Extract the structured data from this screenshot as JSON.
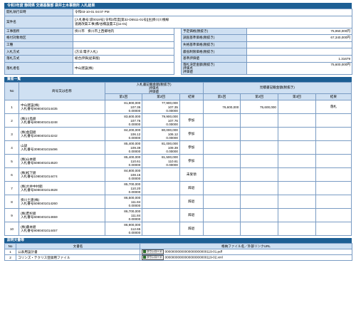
{
  "title": "令和3年度 静岡県 交通基盤部 袋井土木事務所 入札結果",
  "info": {
    "rows": [
      {
        "label": "開札執行日時",
        "value": "令和03-10-01 04:07 PM"
      },
      {
        "label": "案件名",
        "value": "[入札番号:袋0019号] 令和3年度[第32-D5511-01号][主]掛川川根線\n道路改築工事(橋/谷橋設置工)[11-01]"
      },
      {
        "label": "工事箇所",
        "value": "掛川市　掛川市上西郷地内"
      },
      {
        "label": "格付対象地区",
        "value": ""
      },
      {
        "label": "工種",
        "value": ""
      },
      {
        "label": "入札方式",
        "value": "(方法:電子入札)"
      },
      {
        "label": "落札方式",
        "value": "総合評価(従来版)"
      },
      {
        "label": "落札者名",
        "value": "中山建設(株)"
      }
    ],
    "right": [
      {
        "label": "予定価格(税抜き)",
        "value": "75,950,000円"
      },
      {
        "label": "調査基準価格(税抜き)",
        "value": "67,340,000円"
      },
      {
        "label": "失格基準価格(税抜き)",
        "value": ""
      },
      {
        "label": "最低制限価格(税抜き)",
        "value": ""
      },
      {
        "label": "基準評価値",
        "value": "1.31679"
      },
      {
        "label": "落札決定金額(税抜き)\n評価点\n評価値",
        "value": "75,600,000円"
      }
    ]
  },
  "bidders": {
    "section_title": "業者一覧",
    "headers": {
      "no": "No",
      "name": "商号又は名称",
      "bid_group": "入札書記載金額(税抜き)\n評価点\n評価値",
      "round1": "第1回",
      "round2": "第2回",
      "result": "結果",
      "neg_group": "見積書記載金額(税抜き)",
      "neg1": "第1回",
      "neg2": "第2回",
      "neg3": "第3回",
      "neg_result": "結果"
    },
    "rows": [
      {
        "no": "1",
        "name": "中山建設(株)",
        "reg": "入札番号9080401014435",
        "r1": [
          "81,800,000",
          "107.35",
          "0.00000"
        ],
        "r2": [
          "77,900,000",
          "107.35",
          "0.00000"
        ],
        "result": "",
        "n1": "76,600,000",
        "n2": "75,600,000",
        "n3": "",
        "nres": "落札"
      },
      {
        "no": "2",
        "name": "(株)川島組",
        "reg": "入札番号8080401014248",
        "r1": [
          "83,600,000",
          "107.76",
          "0.00000"
        ],
        "r2": [
          "79,900,000",
          "107.76",
          "0.00000"
        ],
        "result": "参加",
        "n1": "",
        "n2": "",
        "n3": "",
        "nres": ""
      },
      {
        "no": "3",
        "name": "(株)金田組",
        "reg": "入札番号2080401014242",
        "r1": [
          "84,200,000",
          "106.12",
          "0.00000"
        ],
        "r2": [
          "80,000,000",
          "106.12",
          "0.00000"
        ],
        "result": "参加",
        "n1": "",
        "n2": "",
        "n3": "",
        "nres": ""
      },
      {
        "no": "4",
        "name": "山訓",
        "reg": "入札番号3080401015496",
        "r1": [
          "85,400,000",
          "109.39",
          "0.00000"
        ],
        "r2": [
          "81,000,000",
          "109.39",
          "0.00000"
        ],
        "result": "参加",
        "n1": "",
        "n2": "",
        "n3": "",
        "nres": ""
      },
      {
        "no": "5",
        "name": "(株)山本組",
        "reg": "入札番号5080401014520",
        "r1": [
          "85,400,000",
          "110.61",
          "0.00000"
        ],
        "r2": [
          "81,500,000",
          "110.61",
          "0.00000"
        ],
        "result": "参加",
        "n1": "",
        "n2": "",
        "n3": "",
        "nres": ""
      },
      {
        "no": "6",
        "name": "(株)松下組",
        "reg": "入札番号1080401014474",
        "r1": [
          "84,800,000",
          "108.16",
          "0.00000"
        ],
        "r2": [
          "",
          "",
          ""
        ],
        "result": "未受領",
        "n1": "",
        "n2": "",
        "n3": "",
        "nres": ""
      },
      {
        "no": "7",
        "name": "(株)大井中村組",
        "reg": "入札番号5080401014628",
        "r1": [
          "85,700,000",
          "110.20",
          "0.00000"
        ],
        "r2": [
          "",
          "",
          ""
        ],
        "result": "辞退",
        "n1": "",
        "n2": "",
        "n3": "",
        "nres": ""
      },
      {
        "no": "8",
        "name": "掛川土建(株)",
        "reg": "入札番号5080401014260",
        "r1": [
          "86,500,000",
          "111.84",
          "0.00000"
        ],
        "r2": [
          "",
          "",
          ""
        ],
        "result": "辞退",
        "n1": "",
        "n2": "",
        "n3": "",
        "nres": ""
      },
      {
        "no": "9",
        "name": "(株)若杉組",
        "reg": "入札番号6080401014659",
        "r1": [
          "86,700,000",
          "111.84",
          "0.00000"
        ],
        "r2": [
          "",
          "",
          ""
        ],
        "result": "辞退",
        "n1": "",
        "n2": "",
        "n3": "",
        "nres": ""
      },
      {
        "no": "10",
        "name": "(株)藤本組",
        "reg": "入札番号9080401014457",
        "r1": [
          "86,900,000",
          "112.65",
          "0.00000"
        ],
        "r2": [
          "",
          "",
          ""
        ],
        "result": "辞退",
        "n1": "",
        "n2": "",
        "n3": "",
        "nres": ""
      }
    ]
  },
  "docs": {
    "section_title": "説明文書等",
    "headers": {
      "no": "No",
      "name": "文書名",
      "file": "格納ファイル名／外部リンクURL"
    },
    "button_label": "ダウンロード",
    "rows": [
      {
        "no": "1",
        "name": "公表用設計書",
        "file": "00000000000000000000000119-01.pdf"
      },
      {
        "no": "2",
        "name": "コリンズ・テクリス登録用ファイル",
        "file": "00000000000000000000000119-02.xml"
      }
    ]
  }
}
